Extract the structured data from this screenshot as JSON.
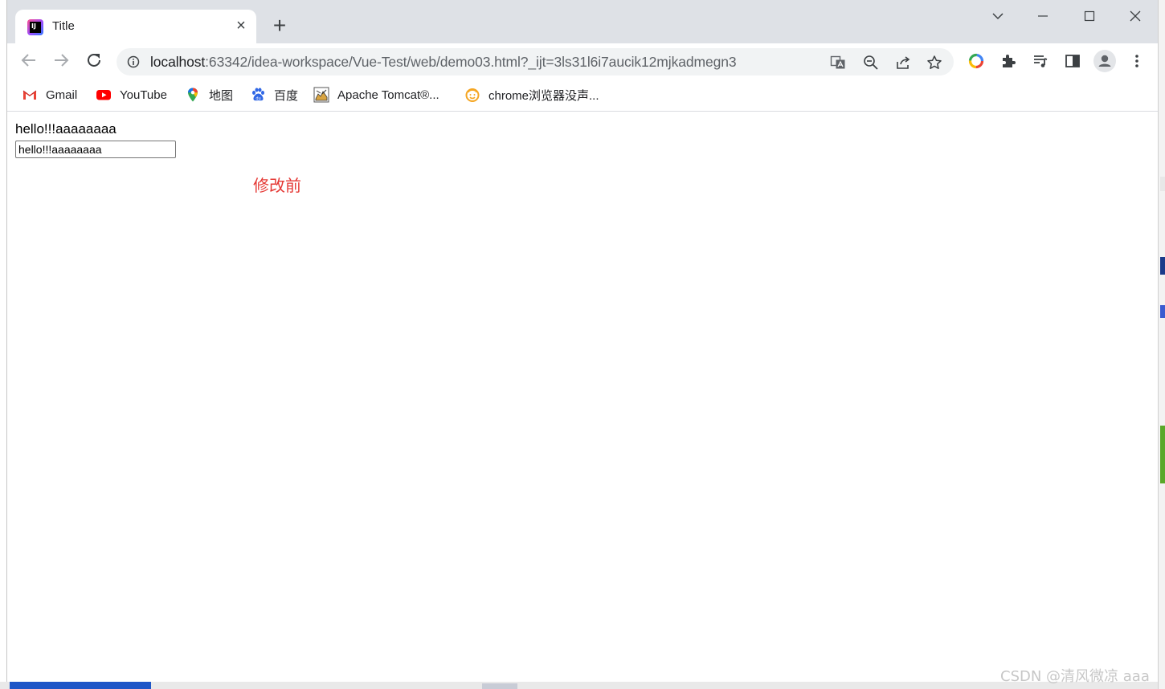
{
  "tab": {
    "title": "Title",
    "close_glyph": "×",
    "favicon_label": "IJ"
  },
  "new_tab_glyph": "+",
  "address": {
    "host": "localhost",
    "rest": ":63342/idea-workspace/Vue-Test/web/demo03.html?_ijt=3ls31l6i7aucik12mjkadmegn3"
  },
  "bookmarks": [
    {
      "label": "Gmail",
      "icon": "gmail-icon"
    },
    {
      "label": "YouTube",
      "icon": "youtube-icon"
    },
    {
      "label": "地图",
      "icon": "maps-pin-icon"
    },
    {
      "label": "百度",
      "icon": "baidu-paw-icon"
    },
    {
      "label": "Apache Tomcat®...",
      "icon": "tomcat-icon"
    },
    {
      "label": "chrome浏览器没声...",
      "icon": "smiley-icon"
    }
  ],
  "page": {
    "message": "hello!!!aaaaaaaa",
    "input_value": "hello!!!aaaaaaaa",
    "status_text": "修改前"
  },
  "watermark": "CSDN @清风微凉 aaa",
  "colors": {
    "titlebar": "#dee1e6",
    "status_red": "#e53935",
    "omnibox": "#f1f3f4"
  }
}
